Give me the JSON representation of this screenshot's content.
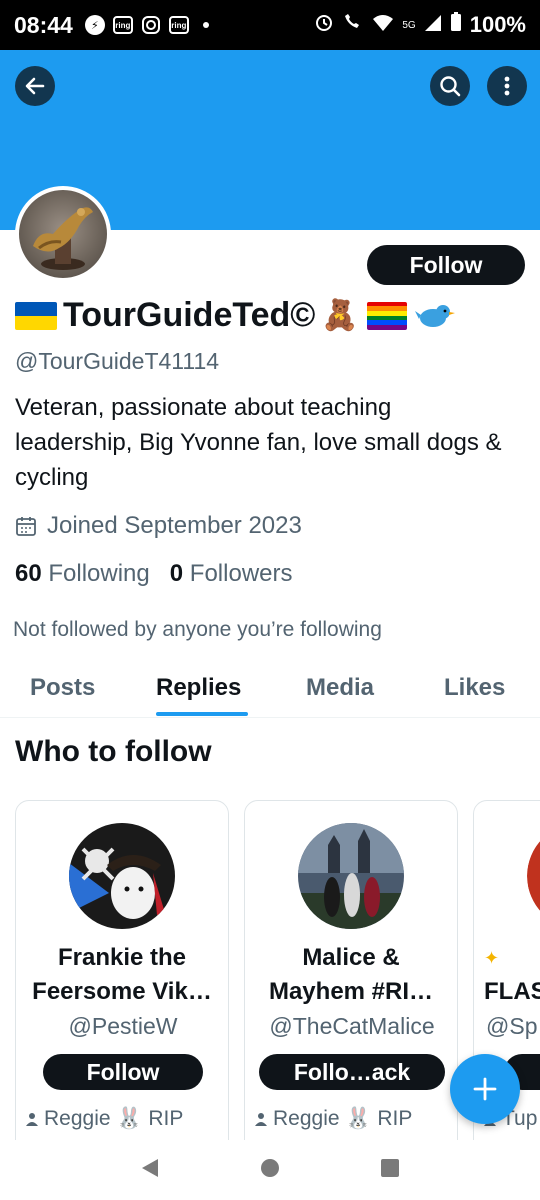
{
  "status_bar": {
    "time": "08:44",
    "battery": "100%",
    "network": "5G",
    "notif_ring_1": "ring",
    "notif_ring_2": "ring"
  },
  "header": {
    "back_icon": "arrow-left-icon",
    "search_icon": "search-icon",
    "more_icon": "more-vertical-icon",
    "banner_color": "#1d9bf0"
  },
  "profile": {
    "display_name": "TourGuideTed©",
    "handle": "@TourGuideT41114",
    "follow_label": "Follow",
    "bio": "Veteran, passionate about teaching leadership, Big Yvonne fan, love small dogs & cycling",
    "joined": "Joined September 2023",
    "following_count": "60",
    "following_label": "Following",
    "followers_count": "0",
    "followers_label": "Followers",
    "not_followed_text": "Not followed by anyone you’re following"
  },
  "tabs": [
    {
      "label": "Posts",
      "active": false
    },
    {
      "label": "Replies",
      "active": true
    },
    {
      "label": "Media",
      "active": false
    },
    {
      "label": "Likes",
      "active": false
    }
  ],
  "who_to_follow": {
    "title": "Who to follow",
    "cards": [
      {
        "name": "Frankie the Feersome Vik…",
        "handle": "@PestieW",
        "button": "Follow",
        "social": "Reggie 🐰 RIP"
      },
      {
        "name": "Malice & Mayhem #RI…",
        "handle": "@TheCatMalice",
        "button": "Follo…ack",
        "social": "Reggie 🐰 RIP"
      },
      {
        "name": "FLAS",
        "handle": "@Sp",
        "button": "",
        "social": "Tup"
      }
    ]
  },
  "fab": {
    "icon": "plus-icon"
  },
  "nav": {
    "back_icon": "nav-back-icon",
    "home_icon": "nav-home-icon",
    "recents_icon": "nav-recents-icon"
  },
  "colors": {
    "accent": "#1d9bf0",
    "text": "#0f1419",
    "muted": "#536471"
  }
}
